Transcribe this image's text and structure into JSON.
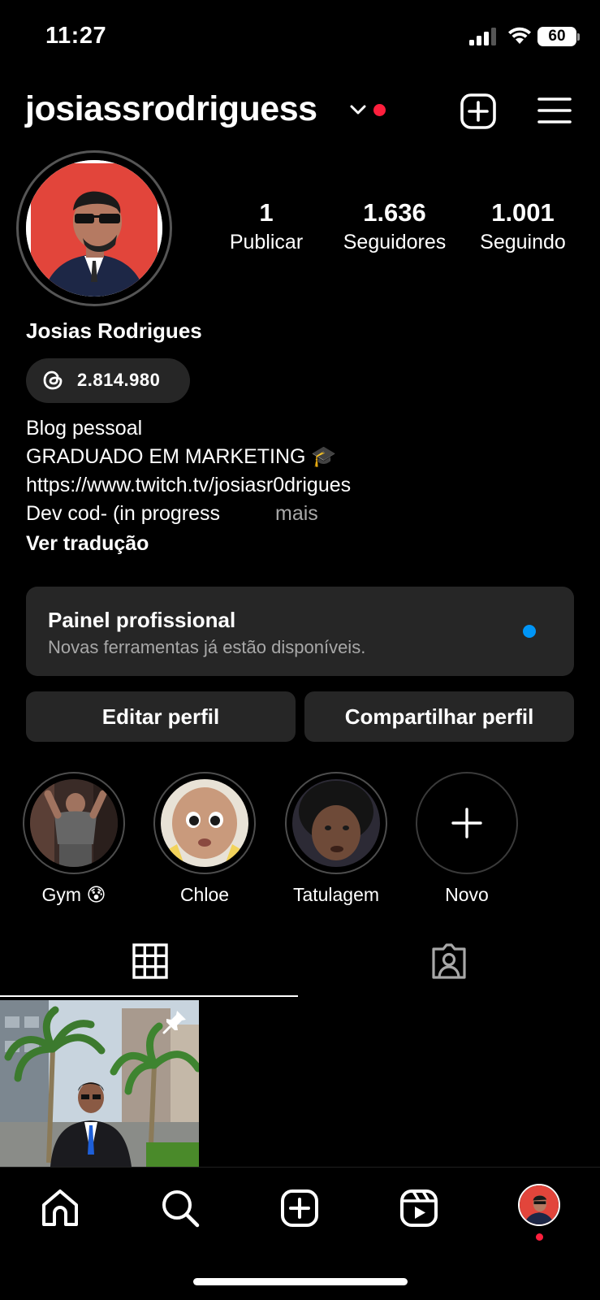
{
  "status_bar": {
    "time": "11:27",
    "battery": "60"
  },
  "header": {
    "username": "josiassrodriguess"
  },
  "profile": {
    "full_name": "Josias Rodrigues",
    "stats": [
      {
        "value": "1",
        "label": "Publicar"
      },
      {
        "value": "1.636",
        "label": "Seguidores"
      },
      {
        "value": "1.001",
        "label": "Seguindo"
      }
    ],
    "threads_count": "2.814.980",
    "bio": [
      "Blog pessoal",
      "GRADUADO EM MARKETING 🎓",
      "https://www.twitch.tv/josiasr0drigues",
      "Dev cod- (in progress"
    ],
    "more_label": "mais",
    "translate_label": "Ver tradução"
  },
  "pro_panel": {
    "title": "Painel profissional",
    "subtitle": "Novas ferramentas já estão disponíveis."
  },
  "actions": {
    "edit": "Editar perfil",
    "share": "Compartilhar perfil"
  },
  "highlights": [
    {
      "label": "Gym 😰"
    },
    {
      "label": "Chloe"
    },
    {
      "label": "Tatulagem"
    },
    {
      "label": "Novo"
    }
  ],
  "colors": {
    "accent_red": "#ff1f3d",
    "accent_blue": "#0095f6",
    "surface": "#262626"
  }
}
